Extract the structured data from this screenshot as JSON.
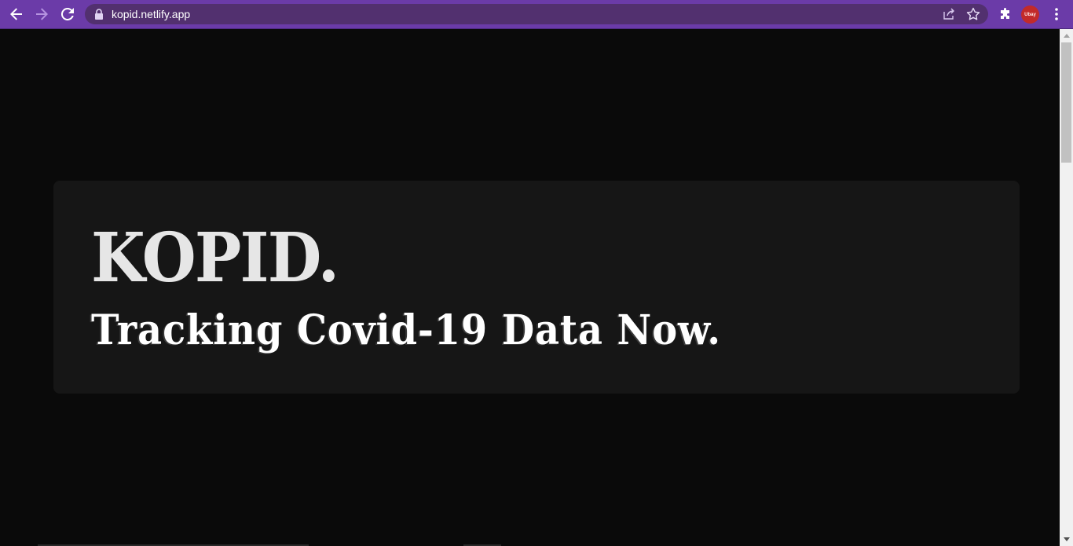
{
  "browser": {
    "url": "kopid.netlify.app",
    "profile_label": "Ubay",
    "icons": {
      "back": "arrow-left-icon",
      "forward": "arrow-right-icon",
      "reload": "reload-icon",
      "lock": "lock-icon",
      "share": "share-icon",
      "bookmark": "star-icon",
      "extensions": "puzzle-icon",
      "menu": "kebab-menu-icon"
    },
    "colors": {
      "toolbar": "#6b3ba8",
      "omnibox": "#52306f"
    }
  },
  "page": {
    "brand": "KOPID.",
    "tagline": "Tracking Covid-19 Data Now.",
    "colors": {
      "background": "#0a0a0a",
      "card": "#161616",
      "brand_text": "#e6e6e6",
      "tagline_text": "#ffffff"
    }
  }
}
